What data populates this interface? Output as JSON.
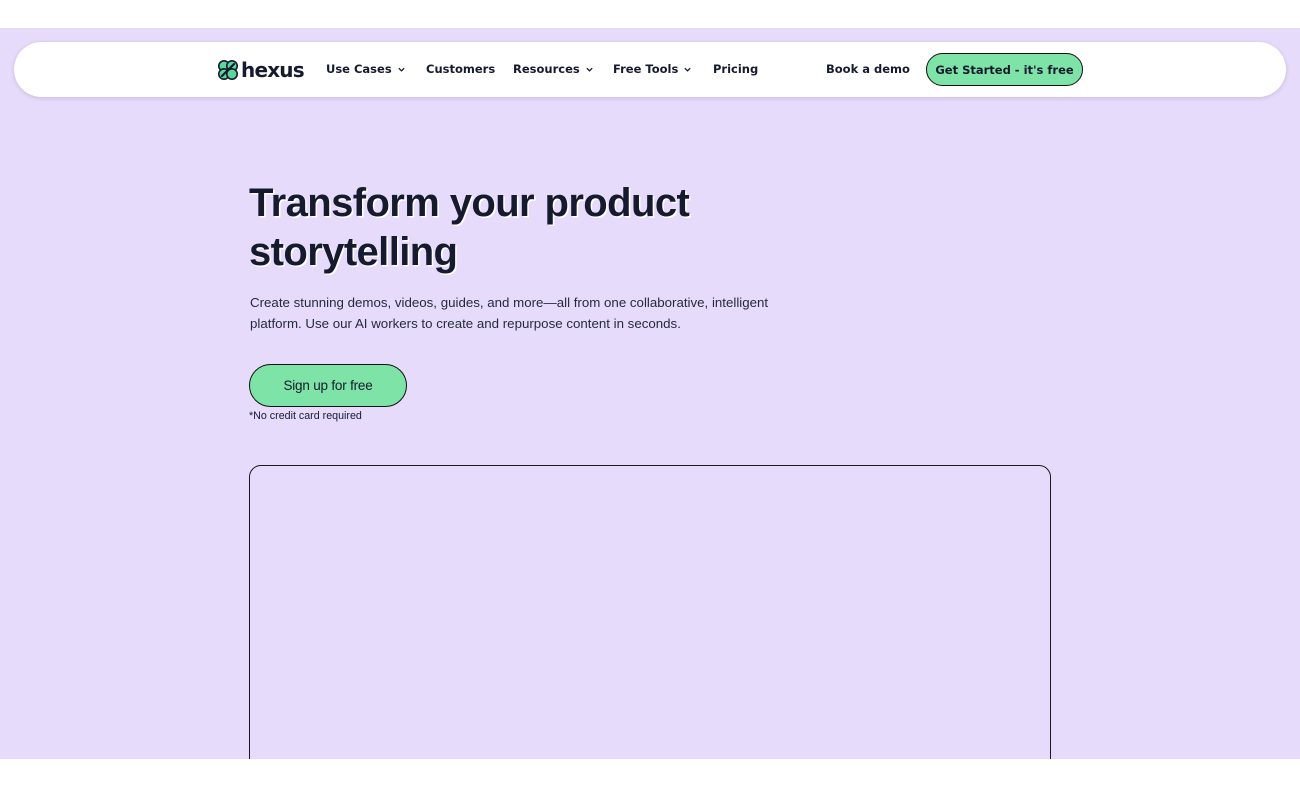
{
  "brand": {
    "name": "hexus",
    "colors": {
      "accent": "#7de3a7",
      "background": "#e6dbfb",
      "text": "#151a2e"
    }
  },
  "nav": {
    "items": [
      {
        "label": "Use Cases",
        "dropdown": true
      },
      {
        "label": "Customers",
        "dropdown": false
      },
      {
        "label": "Resources",
        "dropdown": true
      },
      {
        "label": "Free Tools",
        "dropdown": true
      },
      {
        "label": "Pricing",
        "dropdown": false
      }
    ],
    "book_demo": "Book a demo",
    "get_started": "Get Started - it's free",
    "chevron_icon": "chevron-down-icon"
  },
  "hero": {
    "headline": "Transform your product storytelling",
    "subtext": "Create stunning demos, videos, guides, and more—all from one collaborative, intelligent platform. Use our AI workers to create and repurpose content in seconds.",
    "cta": "Sign up for free",
    "note": "*No credit card required"
  }
}
